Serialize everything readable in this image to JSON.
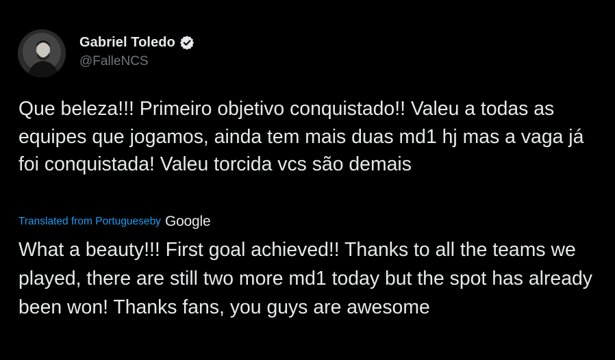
{
  "author": {
    "display_name": "Gabriel Toledo",
    "handle": "@FalleNCS",
    "verified": true,
    "verified_icon": "verified-badge-icon"
  },
  "tweet": {
    "original_text": "Que beleza!!! Primeiro objetivo conquistado!! Valeu a todas as equipes que jogamos, ainda tem mais duas md1 hj mas a vaga já foi conquistada! Valeu torcida vcs são demais",
    "translation_label": "Translated from Portuguese",
    "translation_by": " by",
    "translation_provider": "Google",
    "translated_text": "What a beauty!!! First goal achieved!! Thanks to all the teams we played, there are still two more md1 today but the spot has already been won! Thanks fans, you guys are awesome"
  },
  "colors": {
    "background": "#000000",
    "text": "#e7e9ea",
    "secondary": "#71767b",
    "accent": "#1d9bf0"
  }
}
